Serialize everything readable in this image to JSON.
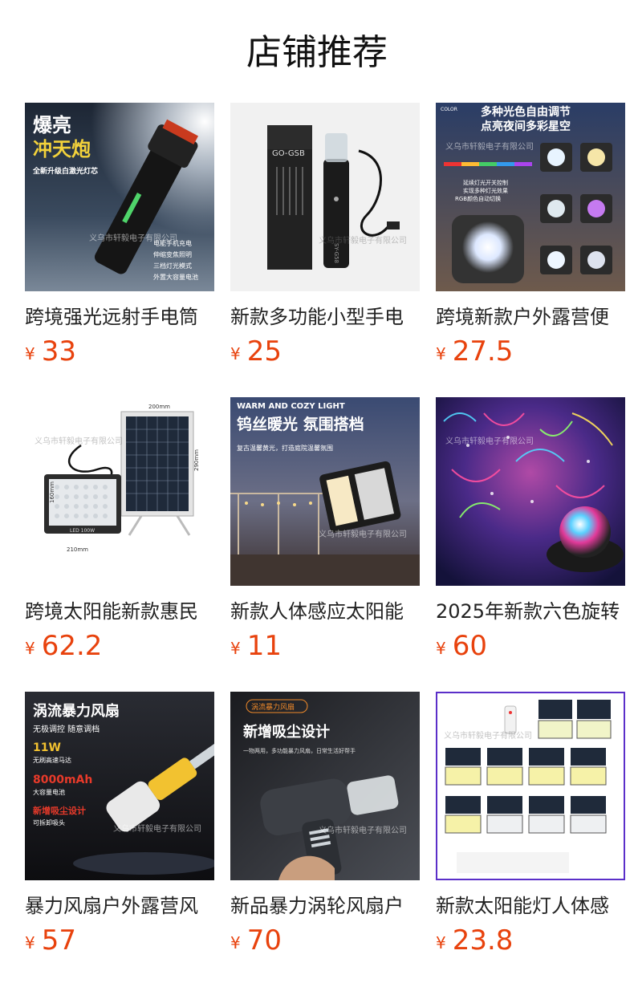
{
  "section_title": "店铺推荐",
  "currency_symbol": "¥",
  "products": [
    {
      "name": "跨境强光远射手电筒",
      "price": "33",
      "image_text": {
        "headline1": "爆亮",
        "headline2": "冲天炮",
        "subline": "全新升级白激光灯芯",
        "features": [
          "电能手机充电",
          "伸缩变焦照明",
          "三档灯光模式",
          "外置大容量电池"
        ],
        "watermark": "义乌市轩毅电子有限公司"
      }
    },
    {
      "name": "新款多功能小型手电",
      "price": "25",
      "image_text": {
        "box_label": "GO-GSB",
        "body_label": "SY-G58",
        "watermark": "义乌市轩毅电子有限公司"
      }
    },
    {
      "name": "跨境新款户外露营便",
      "price": "27.5",
      "image_text": {
        "headline1": "多种光色自由调节",
        "headline2": "点亮夜间多彩星空",
        "small": "COLOR",
        "note1": "延续灯光开关控制",
        "note2": "实现多种灯光效果",
        "note3": "RGB颜色自动切换",
        "watermark": "义乌市轩毅电子有限公司"
      }
    },
    {
      "name": "跨境太阳能新款惠民",
      "price": "62.2",
      "image_text": {
        "dim_top": "200mm",
        "dim_right": "290mm",
        "dim_left": "160mm",
        "dim_bottom": "210mm",
        "lamp_label": "LED 100W",
        "watermark": "义乌市轩毅电子有限公司"
      }
    },
    {
      "name": "新款人体感应太阳能",
      "price": "11",
      "image_text": {
        "headline_en": "WARM AND COZY LIGHT",
        "headline1": "钨丝暖光 氛围搭档",
        "subline": "复古温馨黄光，打造庭院温馨氛围",
        "watermark": "义乌市轩毅电子有限公司"
      }
    },
    {
      "name": "2025年新款六色旋转",
      "price": "60",
      "image_text": {
        "watermark": "义乌市轩毅电子有限公司"
      }
    },
    {
      "name": "暴力风扇户外露营风",
      "price": "57",
      "image_text": {
        "headline1": "涡流暴力风扇",
        "sub1": "无极调控 随意调档",
        "spec1": "11W",
        "spec1_note": "无刷高速马达",
        "spec2": "8000mAh",
        "spec2_note": "大容量电池",
        "spec3": "新增吸尘设计",
        "spec3_note": "可拆卸吸头",
        "watermark": "义乌市轩毅电子有限公司"
      }
    },
    {
      "name": "新品暴力涡轮风扇户",
      "price": "70",
      "image_text": {
        "tag": "涡流暴力风扇",
        "headline1": "新增吸尘设计",
        "subline": "一物两用，多功能暴力风扇，日常生活好帮手",
        "watermark": "义乌市轩毅电子有限公司"
      }
    },
    {
      "name": "新款太阳能灯人体感",
      "price": "23.8",
      "image_text": {
        "watermark": "义乌市轩毅电子有限公司"
      }
    }
  ],
  "colors": {
    "price": "#e8420d",
    "title": "#111111"
  }
}
